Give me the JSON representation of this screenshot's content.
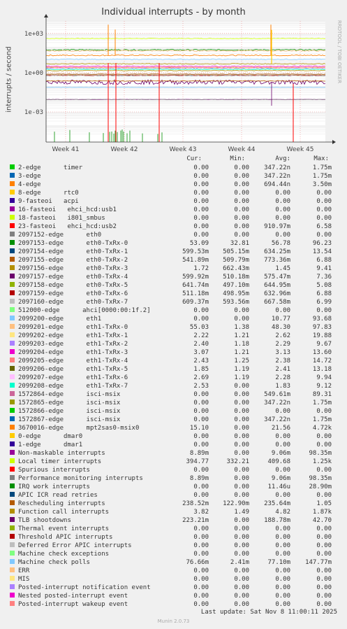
{
  "title": "Individual interrupts - by month",
  "ylabel": "interrupts / second",
  "side_label": "RRDTOOL / TOBI OETIKER",
  "last_update": "Last update: Sat Nov  8 11:00:11 2025",
  "footer": "Munin 2.0.73",
  "columns": [
    "Cur:",
    "Min:",
    "Avg:",
    "Max:"
  ],
  "chart_data": {
    "type": "line",
    "title": "Individual interrupts - by month",
    "ylabel": "interrupts / second",
    "yscale": "log",
    "ylim": [
      5e-06,
      9000
    ],
    "y_ticks": [
      "1e-03",
      "1e+00",
      "1e+03"
    ],
    "x_ticks": [
      "Week 41",
      "Week 42",
      "Week 43",
      "Week 44",
      "Week 45"
    ],
    "series": [
      {
        "name": "2-edge      timer",
        "color": "#00cc00",
        "cur": "0.00",
        "min": "0.00",
        "avg": "347.22n",
        "max": "1.75m"
      },
      {
        "name": "3-edge",
        "color": "#0066b3",
        "cur": "0.00",
        "min": "0.00",
        "avg": "347.22n",
        "max": "1.75m"
      },
      {
        "name": "4-edge",
        "color": "#ff8000",
        "cur": "0.00",
        "min": "0.00",
        "avg": "694.44n",
        "max": "3.50m"
      },
      {
        "name": "8-edge      rtc0",
        "color": "#ffcc00",
        "cur": "0.00",
        "min": "0.00",
        "avg": "0.00",
        "max": "0.00"
      },
      {
        "name": "9-fasteoi   acpi",
        "color": "#330099",
        "cur": "0.00",
        "min": "0.00",
        "avg": "0.00",
        "max": "0.00"
      },
      {
        "name": "16-fasteoi   ehci_hcd:usb1",
        "color": "#990099",
        "cur": "0.00",
        "min": "0.00",
        "avg": "0.00",
        "max": "0.00"
      },
      {
        "name": "18-fasteoi   i801_smbus",
        "color": "#ccff00",
        "cur": "0.00",
        "min": "0.00",
        "avg": "0.00",
        "max": "0.00"
      },
      {
        "name": "23-fasteoi   ehci_hcd:usb2",
        "color": "#ff0000",
        "cur": "0.00",
        "min": "0.00",
        "avg": "910.97m",
        "max": "6.58"
      },
      {
        "name": "2097152-edge      eth0",
        "color": "#808080",
        "cur": "0.00",
        "min": "0.00",
        "avg": "0.00",
        "max": "0.00"
      },
      {
        "name": "2097153-edge      eth0-TxRx-0",
        "color": "#008f00",
        "cur": "53.09",
        "min": "32.81",
        "avg": "56.78",
        "max": "96.23"
      },
      {
        "name": "2097154-edge      eth0-TxRx-1",
        "color": "#00487d",
        "cur": "599.53m",
        "min": "505.15m",
        "avg": "634.25m",
        "max": "13.54"
      },
      {
        "name": "2097155-edge      eth0-TxRx-2",
        "color": "#b35a00",
        "cur": "541.89m",
        "min": "509.79m",
        "avg": "773.36m",
        "max": "6.88"
      },
      {
        "name": "2097156-edge      eth0-TxRx-3",
        "color": "#b38f00",
        "cur": "1.72",
        "min": "662.43m",
        "avg": "1.45",
        "max": "9.41"
      },
      {
        "name": "2097157-edge      eth0-TxRx-4",
        "color": "#6b006b",
        "cur": "599.92m",
        "min": "510.18m",
        "avg": "575.47m",
        "max": "7.36"
      },
      {
        "name": "2097158-edge      eth0-TxRx-5",
        "color": "#8fb300",
        "cur": "641.74m",
        "min": "497.10m",
        "avg": "644.95m",
        "max": "5.08"
      },
      {
        "name": "2097159-edge      eth0-TxRx-6",
        "color": "#b30000",
        "cur": "511.18m",
        "min": "498.95m",
        "avg": "632.96m",
        "max": "6.88"
      },
      {
        "name": "2097160-edge      eth0-TxRx-7",
        "color": "#bebebe",
        "cur": "609.37m",
        "min": "593.56m",
        "avg": "667.58m",
        "max": "6.99"
      },
      {
        "name": "512000-edge      ahci[0000:00:1f.2]",
        "color": "#80ff80",
        "cur": "0.00",
        "min": "0.00",
        "avg": "0.00",
        "max": "0.00"
      },
      {
        "name": "2099200-edge      eth1",
        "color": "#80c9ff",
        "cur": "0.00",
        "min": "0.00",
        "avg": "10.77",
        "max": "93.68"
      },
      {
        "name": "2099201-edge      eth1-TxRx-0",
        "color": "#ffc080",
        "cur": "55.03",
        "min": "1.38",
        "avg": "48.30",
        "max": "97.83"
      },
      {
        "name": "2099202-edge      eth1-TxRx-1",
        "color": "#ffe680",
        "cur": "2.22",
        "min": "1.21",
        "avg": "2.62",
        "max": "19.88"
      },
      {
        "name": "2099203-edge      eth1-TxRx-2",
        "color": "#aa80ff",
        "cur": "2.40",
        "min": "1.18",
        "avg": "2.29",
        "max": "9.67"
      },
      {
        "name": "2099204-edge      eth1-TxRx-3",
        "color": "#ee00cc",
        "cur": "3.07",
        "min": "1.21",
        "avg": "3.13",
        "max": "13.60"
      },
      {
        "name": "2099205-edge      eth1-TxRx-4",
        "color": "#ff8080",
        "cur": "2.43",
        "min": "1.25",
        "avg": "2.38",
        "max": "14.72"
      },
      {
        "name": "2099206-edge      eth1-TxRx-5",
        "color": "#666600",
        "cur": "1.85",
        "min": "1.19",
        "avg": "2.41",
        "max": "13.18"
      },
      {
        "name": "2099207-edge      eth1-TxRx-6",
        "color": "#ffbfff",
        "cur": "2.69",
        "min": "1.19",
        "avg": "2.28",
        "max": "9.94"
      },
      {
        "name": "2099208-edge      eth1-TxRx-7",
        "color": "#00ffcc",
        "cur": "2.53",
        "min": "0.00",
        "avg": "1.83",
        "max": "9.12"
      },
      {
        "name": "1572864-edge      isci-msix",
        "color": "#cc6699",
        "cur": "0.00",
        "min": "0.00",
        "avg": "549.61m",
        "max": "89.31"
      },
      {
        "name": "1572865-edge      isci-msix",
        "color": "#999900",
        "cur": "0.00",
        "min": "0.00",
        "avg": "347.22n",
        "max": "1.75m"
      },
      {
        "name": "1572866-edge      isci-msix",
        "color": "#00cc00",
        "cur": "0.00",
        "min": "0.00",
        "avg": "0.00",
        "max": "0.00"
      },
      {
        "name": "1572867-edge      isci-msix",
        "color": "#0066b3",
        "cur": "0.00",
        "min": "0.00",
        "avg": "347.22n",
        "max": "1.75m"
      },
      {
        "name": "3670016-edge      mpt2sas0-msix0",
        "color": "#ff8000",
        "cur": "15.10",
        "min": "0.00",
        "avg": "21.56",
        "max": "4.72k"
      },
      {
        "name": "0-edge      dmar0",
        "color": "#ffcc00",
        "cur": "0.00",
        "min": "0.00",
        "avg": "0.00",
        "max": "0.00"
      },
      {
        "name": "1-edge      dmar1",
        "color": "#330099",
        "cur": "0.00",
        "min": "0.00",
        "avg": "0.00",
        "max": "0.00"
      },
      {
        "name": "Non-maskable interrupts",
        "color": "#990099",
        "cur": "8.89m",
        "min": "0.00",
        "avg": "9.06m",
        "max": "98.35m"
      },
      {
        "name": "Local timer interrupts",
        "color": "#ccff00",
        "cur": "394.77",
        "min": "332.21",
        "avg": "409.68",
        "max": "1.25k"
      },
      {
        "name": "Spurious interrupts",
        "color": "#ff0000",
        "cur": "0.00",
        "min": "0.00",
        "avg": "0.00",
        "max": "0.00"
      },
      {
        "name": "Performance monitoring interrupts",
        "color": "#808080",
        "cur": "8.89m",
        "min": "0.00",
        "avg": "9.06m",
        "max": "98.35m"
      },
      {
        "name": "IRQ work interrupts",
        "color": "#008f00",
        "cur": "0.00",
        "min": "0.00",
        "avg": "11.46u",
        "max": "28.90m"
      },
      {
        "name": "APIC ICR read retries",
        "color": "#00487d",
        "cur": "0.00",
        "min": "0.00",
        "avg": "0.00",
        "max": "0.00"
      },
      {
        "name": "Rescheduling interrupts",
        "color": "#b35a00",
        "cur": "238.52m",
        "min": "122.90m",
        "avg": "235.64m",
        "max": "1.05"
      },
      {
        "name": "Function call interrupts",
        "color": "#b38f00",
        "cur": "3.82",
        "min": "1.49",
        "avg": "4.82",
        "max": "1.87k"
      },
      {
        "name": "TLB shootdowns",
        "color": "#6b006b",
        "cur": "223.21m",
        "min": "0.00",
        "avg": "188.78m",
        "max": "42.70"
      },
      {
        "name": "Thermal event interrupts",
        "color": "#8fb300",
        "cur": "0.00",
        "min": "0.00",
        "avg": "0.00",
        "max": "0.00"
      },
      {
        "name": "Threshold APIC interrupts",
        "color": "#b30000",
        "cur": "0.00",
        "min": "0.00",
        "avg": "0.00",
        "max": "0.00"
      },
      {
        "name": "Deferred Error APIC interrupts",
        "color": "#bebebe",
        "cur": "0.00",
        "min": "0.00",
        "avg": "0.00",
        "max": "0.00"
      },
      {
        "name": "Machine check exceptions",
        "color": "#80ff80",
        "cur": "0.00",
        "min": "0.00",
        "avg": "0.00",
        "max": "0.00"
      },
      {
        "name": "Machine check polls",
        "color": "#80c9ff",
        "cur": "76.66m",
        "min": "2.41m",
        "avg": "77.10m",
        "max": "147.77m"
      },
      {
        "name": "ERR",
        "color": "#ffc080",
        "cur": "0.00",
        "min": "0.00",
        "avg": "0.00",
        "max": "0.00"
      },
      {
        "name": "MIS",
        "color": "#ffe680",
        "cur": "0.00",
        "min": "0.00",
        "avg": "0.00",
        "max": "0.00"
      },
      {
        "name": "Posted-interrupt notification event",
        "color": "#aa80ff",
        "cur": "0.00",
        "min": "0.00",
        "avg": "0.00",
        "max": "0.00"
      },
      {
        "name": "Nested posted-interrupt event",
        "color": "#ee00cc",
        "cur": "0.00",
        "min": "0.00",
        "avg": "0.00",
        "max": "0.00"
      },
      {
        "name": "Posted-interrupt wakeup event",
        "color": "#ff8080",
        "cur": "0.00",
        "min": "0.00",
        "avg": "0.00",
        "max": "0.00"
      }
    ]
  }
}
